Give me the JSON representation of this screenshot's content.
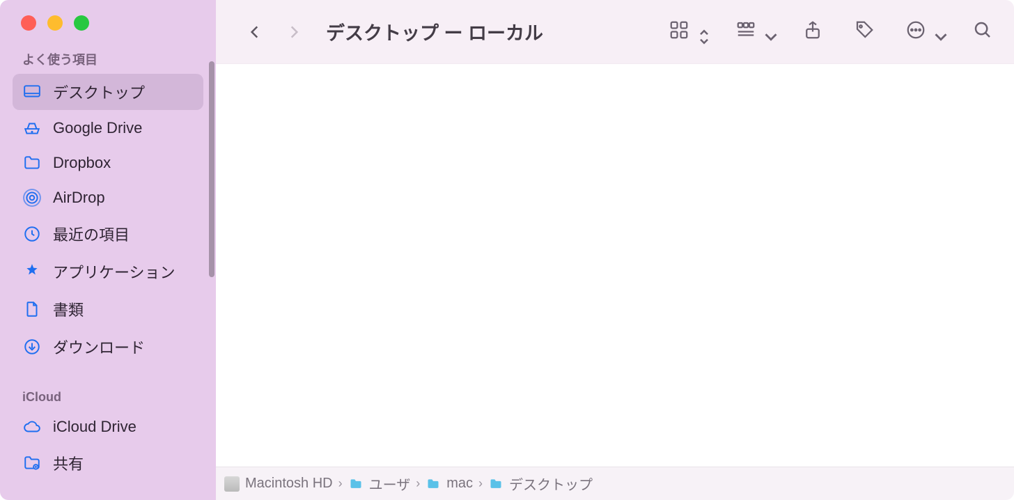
{
  "window": {
    "title": "デスクトップ ー ローカル"
  },
  "sidebar": {
    "sections": [
      {
        "header": "よく使う項目",
        "items": [
          {
            "icon": "desktop-icon",
            "label": "デスクトップ",
            "selected": true
          },
          {
            "icon": "drive-icon",
            "label": "Google Drive"
          },
          {
            "icon": "folder-icon",
            "label": "Dropbox"
          },
          {
            "icon": "airdrop-icon",
            "label": "AirDrop"
          },
          {
            "icon": "clock-icon",
            "label": "最近の項目"
          },
          {
            "icon": "apps-icon",
            "label": "アプリケーション"
          },
          {
            "icon": "doc-icon",
            "label": "書類"
          },
          {
            "icon": "download-icon",
            "label": "ダウンロード"
          }
        ]
      },
      {
        "header": "iCloud",
        "items": [
          {
            "icon": "cloud-icon",
            "label": "iCloud Drive"
          },
          {
            "icon": "shared-icon",
            "label": "共有"
          }
        ]
      }
    ]
  },
  "path": [
    {
      "icon": "disk",
      "label": "Macintosh HD"
    },
    {
      "icon": "fold",
      "label": "ユーザ"
    },
    {
      "icon": "fold",
      "label": "mac"
    },
    {
      "icon": "fold",
      "label": "デスクトップ"
    }
  ]
}
